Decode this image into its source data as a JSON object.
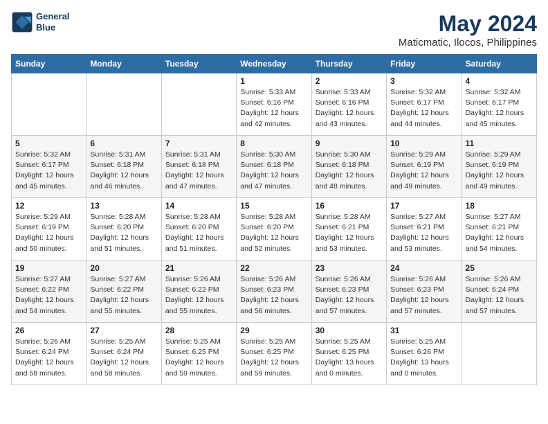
{
  "header": {
    "logo_line1": "General",
    "logo_line2": "Blue",
    "title": "May 2024",
    "subtitle": "Maticmatic, Ilocos, Philippines"
  },
  "days_of_week": [
    "Sunday",
    "Monday",
    "Tuesday",
    "Wednesday",
    "Thursday",
    "Friday",
    "Saturday"
  ],
  "weeks": [
    [
      {
        "day": "",
        "content": ""
      },
      {
        "day": "",
        "content": ""
      },
      {
        "day": "",
        "content": ""
      },
      {
        "day": "1",
        "content": "Sunrise: 5:33 AM\nSunset: 6:16 PM\nDaylight: 12 hours\nand 42 minutes."
      },
      {
        "day": "2",
        "content": "Sunrise: 5:33 AM\nSunset: 6:16 PM\nDaylight: 12 hours\nand 43 minutes."
      },
      {
        "day": "3",
        "content": "Sunrise: 5:32 AM\nSunset: 6:17 PM\nDaylight: 12 hours\nand 44 minutes."
      },
      {
        "day": "4",
        "content": "Sunrise: 5:32 AM\nSunset: 6:17 PM\nDaylight: 12 hours\nand 45 minutes."
      }
    ],
    [
      {
        "day": "5",
        "content": "Sunrise: 5:32 AM\nSunset: 6:17 PM\nDaylight: 12 hours\nand 45 minutes."
      },
      {
        "day": "6",
        "content": "Sunrise: 5:31 AM\nSunset: 6:18 PM\nDaylight: 12 hours\nand 46 minutes."
      },
      {
        "day": "7",
        "content": "Sunrise: 5:31 AM\nSunset: 6:18 PM\nDaylight: 12 hours\nand 47 minutes."
      },
      {
        "day": "8",
        "content": "Sunrise: 5:30 AM\nSunset: 6:18 PM\nDaylight: 12 hours\nand 47 minutes."
      },
      {
        "day": "9",
        "content": "Sunrise: 5:30 AM\nSunset: 6:18 PM\nDaylight: 12 hours\nand 48 minutes."
      },
      {
        "day": "10",
        "content": "Sunrise: 5:29 AM\nSunset: 6:19 PM\nDaylight: 12 hours\nand 49 minutes."
      },
      {
        "day": "11",
        "content": "Sunrise: 5:29 AM\nSunset: 6:19 PM\nDaylight: 12 hours\nand 49 minutes."
      }
    ],
    [
      {
        "day": "12",
        "content": "Sunrise: 5:29 AM\nSunset: 6:19 PM\nDaylight: 12 hours\nand 50 minutes."
      },
      {
        "day": "13",
        "content": "Sunrise: 5:28 AM\nSunset: 6:20 PM\nDaylight: 12 hours\nand 51 minutes."
      },
      {
        "day": "14",
        "content": "Sunrise: 5:28 AM\nSunset: 6:20 PM\nDaylight: 12 hours\nand 51 minutes."
      },
      {
        "day": "15",
        "content": "Sunrise: 5:28 AM\nSunset: 6:20 PM\nDaylight: 12 hours\nand 52 minutes."
      },
      {
        "day": "16",
        "content": "Sunrise: 5:28 AM\nSunset: 6:21 PM\nDaylight: 12 hours\nand 53 minutes."
      },
      {
        "day": "17",
        "content": "Sunrise: 5:27 AM\nSunset: 6:21 PM\nDaylight: 12 hours\nand 53 minutes."
      },
      {
        "day": "18",
        "content": "Sunrise: 5:27 AM\nSunset: 6:21 PM\nDaylight: 12 hours\nand 54 minutes."
      }
    ],
    [
      {
        "day": "19",
        "content": "Sunrise: 5:27 AM\nSunset: 6:22 PM\nDaylight: 12 hours\nand 54 minutes."
      },
      {
        "day": "20",
        "content": "Sunrise: 5:27 AM\nSunset: 6:22 PM\nDaylight: 12 hours\nand 55 minutes."
      },
      {
        "day": "21",
        "content": "Sunrise: 5:26 AM\nSunset: 6:22 PM\nDaylight: 12 hours\nand 55 minutes."
      },
      {
        "day": "22",
        "content": "Sunrise: 5:26 AM\nSunset: 6:23 PM\nDaylight: 12 hours\nand 56 minutes."
      },
      {
        "day": "23",
        "content": "Sunrise: 5:26 AM\nSunset: 6:23 PM\nDaylight: 12 hours\nand 57 minutes."
      },
      {
        "day": "24",
        "content": "Sunrise: 5:26 AM\nSunset: 6:23 PM\nDaylight: 12 hours\nand 57 minutes."
      },
      {
        "day": "25",
        "content": "Sunrise: 5:26 AM\nSunset: 6:24 PM\nDaylight: 12 hours\nand 57 minutes."
      }
    ],
    [
      {
        "day": "26",
        "content": "Sunrise: 5:26 AM\nSunset: 6:24 PM\nDaylight: 12 hours\nand 58 minutes."
      },
      {
        "day": "27",
        "content": "Sunrise: 5:25 AM\nSunset: 6:24 PM\nDaylight: 12 hours\nand 58 minutes."
      },
      {
        "day": "28",
        "content": "Sunrise: 5:25 AM\nSunset: 6:25 PM\nDaylight: 12 hours\nand 59 minutes."
      },
      {
        "day": "29",
        "content": "Sunrise: 5:25 AM\nSunset: 6:25 PM\nDaylight: 12 hours\nand 59 minutes."
      },
      {
        "day": "30",
        "content": "Sunrise: 5:25 AM\nSunset: 6:25 PM\nDaylight: 13 hours\nand 0 minutes."
      },
      {
        "day": "31",
        "content": "Sunrise: 5:25 AM\nSunset: 6:26 PM\nDaylight: 13 hours\nand 0 minutes."
      },
      {
        "day": "",
        "content": ""
      }
    ]
  ]
}
